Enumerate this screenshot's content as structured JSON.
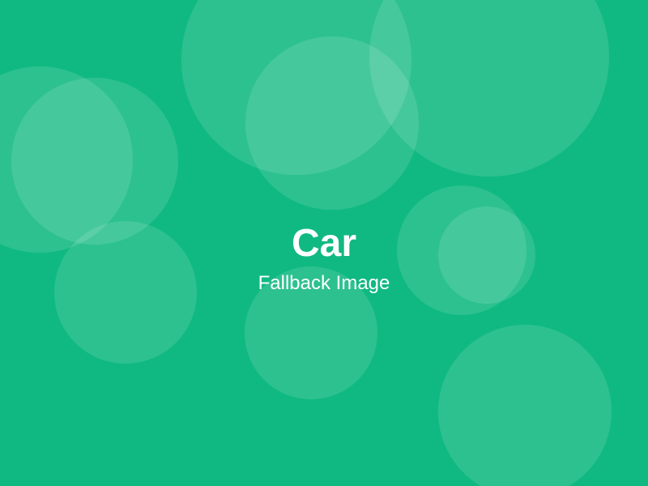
{
  "placeholder": {
    "title": "Car",
    "subtitle": "Fallback Image",
    "background_color": "#10b981",
    "text_color": "#ffffff"
  }
}
